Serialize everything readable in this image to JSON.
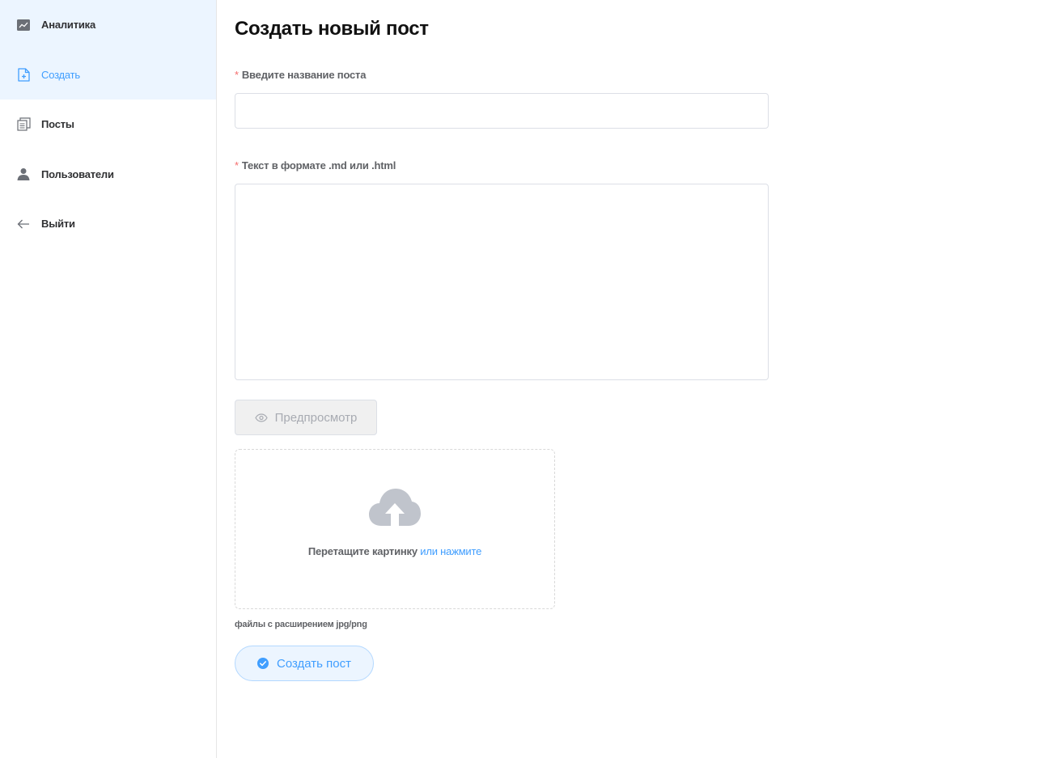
{
  "sidebar": {
    "items": [
      {
        "label": "Аналитика",
        "icon": "chart-icon"
      },
      {
        "label": "Создать",
        "icon": "document-add-icon",
        "active": true
      },
      {
        "label": "Посты",
        "icon": "documents-icon"
      },
      {
        "label": "Пользователи",
        "icon": "user-icon"
      },
      {
        "label": "Выйти",
        "icon": "arrow-left-icon"
      }
    ]
  },
  "main": {
    "title": "Создать новый пост",
    "title_field": {
      "required_mark": "*",
      "label": "Введите название поста",
      "value": "",
      "placeholder": ""
    },
    "body_field": {
      "required_mark": "*",
      "label": "Текст в формате .md или .html",
      "value": "",
      "placeholder": ""
    },
    "preview_button": {
      "label": "Предпросмотр",
      "icon": "eye-icon",
      "disabled": true
    },
    "upload": {
      "icon": "upload-cloud-icon",
      "text": "Перетащите картинку ",
      "link_text": "или нажмите",
      "tip": "файлы с расширением jpg/png"
    },
    "create_button": {
      "label": "Создать пост",
      "icon": "check-circle-icon"
    }
  },
  "colors": {
    "accent": "#409eff",
    "accent_bg": "#ecf5ff",
    "required": "#f56c6c",
    "border": "#dcdfe6",
    "disabled_text": "#a8abb2"
  }
}
